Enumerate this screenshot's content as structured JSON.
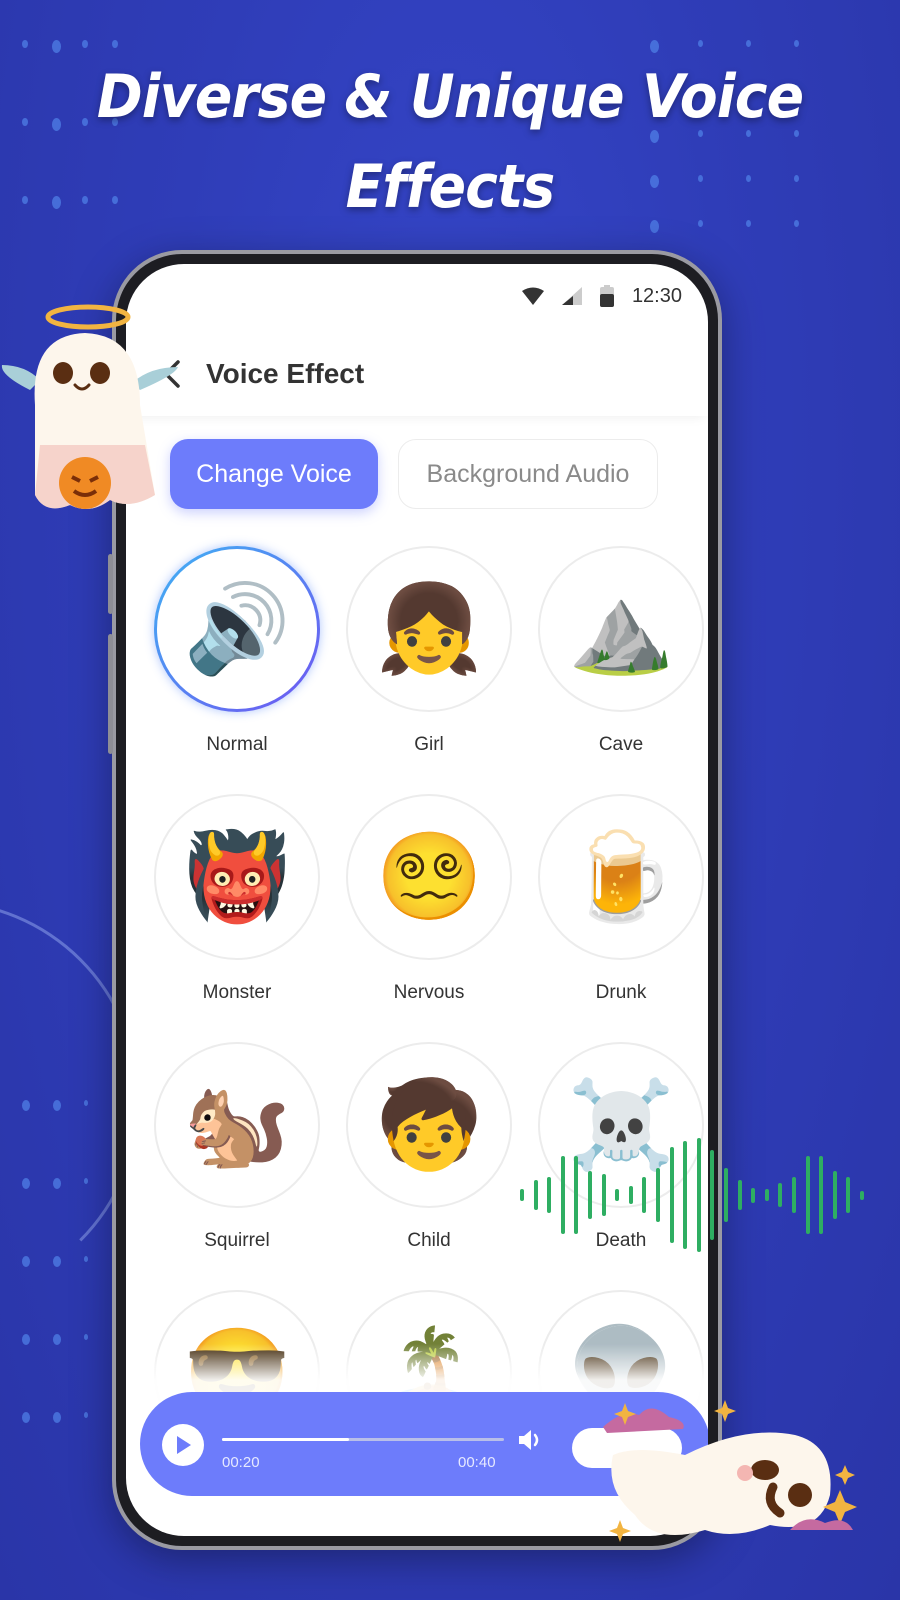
{
  "headline": {
    "line1": "Diverse & Unique Voice",
    "line2": "Effects"
  },
  "status_bar": {
    "wifi_icon": "wifi-icon",
    "signal_icon": "cell-signal-icon",
    "battery_icon": "battery-icon",
    "time": "12:30"
  },
  "app_bar": {
    "back_icon": "chevron-left-icon",
    "title": "Voice Effect"
  },
  "tabs": [
    {
      "label": "Change Voice",
      "active": true
    },
    {
      "label": "Background Audio",
      "active": false
    }
  ],
  "effects": [
    {
      "label": "Normal",
      "icon": "🔊",
      "icon_name": "speaker-icon",
      "selected": true
    },
    {
      "label": "Girl",
      "icon": "👧",
      "icon_name": "girl-icon",
      "selected": false
    },
    {
      "label": "Cave",
      "icon": "⛰️",
      "icon_name": "cave-icon",
      "selected": false
    },
    {
      "label": "Monster",
      "icon": "👹",
      "icon_name": "monster-icon",
      "selected": false
    },
    {
      "label": "Nervous",
      "icon": "😵‍💫",
      "icon_name": "nervous-face-icon",
      "selected": false
    },
    {
      "label": "Drunk",
      "icon": "🍺",
      "icon_name": "beer-mug-icon",
      "selected": false
    },
    {
      "label": "Squirrel",
      "icon": "🐿️",
      "icon_name": "squirrel-icon",
      "selected": false
    },
    {
      "label": "Child",
      "icon": "🧒",
      "icon_name": "child-icon",
      "selected": false
    },
    {
      "label": "Death",
      "icon": "☠️",
      "icon_name": "skull-crossbones-icon",
      "selected": false
    },
    {
      "label": "",
      "icon": "😎",
      "icon_name": "sunglasses-man-icon",
      "selected": false
    },
    {
      "label": "",
      "icon": "🏝️",
      "icon_name": "island-icon",
      "selected": false
    },
    {
      "label": "",
      "icon": "👽",
      "icon_name": "alien-icon",
      "selected": false
    }
  ],
  "player": {
    "play_icon": "play-icon",
    "current_time": "00:20",
    "total_time": "00:40",
    "progress": 0.45,
    "volume_icon": "volume-icon"
  },
  "colors": {
    "background": "#2f3db8",
    "accent": "#6d7cfb",
    "waveform": "#2eae62"
  },
  "waveform_levels": [
    0.2,
    0.5,
    0.6,
    1.3,
    1.3,
    0.8,
    0.7,
    0.2,
    0.3,
    0.6,
    0.9,
    1.6,
    1.8,
    1.9,
    1.5,
    0.9,
    0.5,
    0.25,
    0.2,
    0.4,
    0.6,
    1.3,
    1.3,
    0.8,
    0.6,
    0.15
  ]
}
